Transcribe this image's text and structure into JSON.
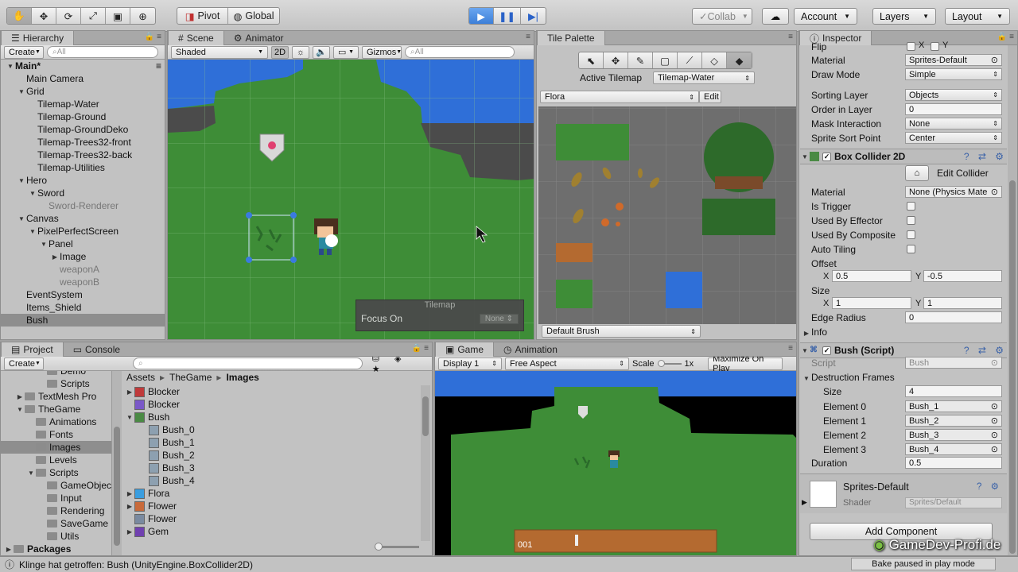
{
  "toolbar": {
    "pivot": "Pivot",
    "global": "Global",
    "collab": "Collab",
    "account": "Account",
    "layers": "Layers",
    "layout": "Layout"
  },
  "hierarchy": {
    "tab": "Hierarchy",
    "create": "Create",
    "search_placeholder": "All",
    "items": [
      {
        "label": "Main*",
        "indent": 0,
        "tri": "▼",
        "bold": true
      },
      {
        "label": "Main Camera",
        "indent": 1,
        "tri": ""
      },
      {
        "label": "Grid",
        "indent": 1,
        "tri": "▼"
      },
      {
        "label": "Tilemap-Water",
        "indent": 2,
        "tri": ""
      },
      {
        "label": "Tilemap-Ground",
        "indent": 2,
        "tri": ""
      },
      {
        "label": "Tilemap-GroundDeko",
        "indent": 2,
        "tri": ""
      },
      {
        "label": "Tilemap-Trees32-front",
        "indent": 2,
        "tri": ""
      },
      {
        "label": "Tilemap-Trees32-back",
        "indent": 2,
        "tri": ""
      },
      {
        "label": "Tilemap-Utilities",
        "indent": 2,
        "tri": ""
      },
      {
        "label": "Hero",
        "indent": 1,
        "tri": "▼"
      },
      {
        "label": "Sword",
        "indent": 2,
        "tri": "▼"
      },
      {
        "label": "Sword-Renderer",
        "indent": 3,
        "tri": "",
        "grey": true
      },
      {
        "label": "Canvas",
        "indent": 1,
        "tri": "▼"
      },
      {
        "label": "PixelPerfectScreen",
        "indent": 2,
        "tri": "▼"
      },
      {
        "label": "Panel",
        "indent": 3,
        "tri": "▼"
      },
      {
        "label": "Image",
        "indent": 4,
        "tri": "▶"
      },
      {
        "label": "weaponA",
        "indent": 4,
        "tri": "",
        "grey": true
      },
      {
        "label": "weaponB",
        "indent": 4,
        "tri": "",
        "grey": true
      },
      {
        "label": "EventSystem",
        "indent": 1,
        "tri": ""
      },
      {
        "label": "Items_Shield",
        "indent": 1,
        "tri": ""
      },
      {
        "label": "Bush",
        "indent": 1,
        "tri": "",
        "selected": true
      }
    ]
  },
  "scene": {
    "tab_scene": "Scene",
    "tab_animator": "Animator",
    "shading": "Shaded",
    "mode2d": "2D",
    "gizmos": "Gizmos",
    "search_placeholder": "All",
    "overlay_title": "Tilemap",
    "focus_label": "Focus On",
    "focus_value": "None"
  },
  "tile_palette": {
    "tab": "Tile Palette",
    "active_tilemap_label": "Active Tilemap",
    "active_tilemap_value": "Tilemap-Water",
    "palette": "Flora",
    "edit": "Edit",
    "brush": "Default Brush"
  },
  "inspector": {
    "tab": "Inspector",
    "flip_label": "Flip",
    "flip_x": "X",
    "flip_y": "Y",
    "material_label": "Material",
    "material_value": "Sprites-Default",
    "draw_mode_label": "Draw Mode",
    "draw_mode_value": "Simple",
    "sorting_layer_label": "Sorting Layer",
    "sorting_layer_value": "Objects",
    "order_label": "Order in Layer",
    "order_value": "0",
    "mask_label": "Mask Interaction",
    "mask_value": "None",
    "sort_point_label": "Sprite Sort Point",
    "sort_point_value": "Center",
    "box_collider": {
      "title": "Box Collider 2D",
      "edit_collider": "Edit Collider",
      "material_label": "Material",
      "material_value": "None (Physics Mate",
      "is_trigger": "Is Trigger",
      "used_by_effector": "Used By Effector",
      "used_by_composite": "Used By Composite",
      "auto_tiling": "Auto Tiling",
      "offset_label": "Offset",
      "offset_x": "0.5",
      "offset_y": "-0.5",
      "size_label": "Size",
      "size_x": "1",
      "size_y": "1",
      "edge_radius_label": "Edge Radius",
      "edge_radius_value": "0",
      "info": "Info",
      "x": "X",
      "y": "Y"
    },
    "bush_script": {
      "title": "Bush (Script)",
      "script_label": "Script",
      "script_value": "Bush",
      "frames_label": "Destruction Frames",
      "size_label": "Size",
      "size_value": "4",
      "elements": [
        {
          "label": "Element 0",
          "value": "Bush_1"
        },
        {
          "label": "Element 1",
          "value": "Bush_2"
        },
        {
          "label": "Element 2",
          "value": "Bush_3"
        },
        {
          "label": "Element 3",
          "value": "Bush_4"
        }
      ],
      "duration_label": "Duration",
      "duration_value": "0.5"
    },
    "material_preview": {
      "name": "Sprites-Default",
      "shader_label": "Shader",
      "shader_value": "Sprites/Default"
    },
    "add_component": "Add Component",
    "watermark": "GameDev-Profi.de"
  },
  "project": {
    "tab_project": "Project",
    "tab_console": "Console",
    "create": "Create",
    "tree": [
      {
        "label": "Demo",
        "indent": 3,
        "tri": ""
      },
      {
        "label": "Scripts",
        "indent": 3,
        "tri": ""
      },
      {
        "label": "TextMesh Pro",
        "indent": 1,
        "tri": "▶"
      },
      {
        "label": "TheGame",
        "indent": 1,
        "tri": "▼"
      },
      {
        "label": "Animations",
        "indent": 2,
        "tri": ""
      },
      {
        "label": "Fonts",
        "indent": 2,
        "tri": ""
      },
      {
        "label": "Images",
        "indent": 2,
        "tri": "",
        "selected": true
      },
      {
        "label": "Levels",
        "indent": 2,
        "tri": ""
      },
      {
        "label": "Scripts",
        "indent": 2,
        "tri": "▼"
      },
      {
        "label": "GameObjec",
        "indent": 3,
        "tri": ""
      },
      {
        "label": "Input",
        "indent": 3,
        "tri": ""
      },
      {
        "label": "Rendering",
        "indent": 3,
        "tri": ""
      },
      {
        "label": "SaveGame",
        "indent": 3,
        "tri": ""
      },
      {
        "label": "Utils",
        "indent": 3,
        "tri": ""
      },
      {
        "label": "Packages",
        "indent": 0,
        "tri": "▶"
      }
    ],
    "breadcrumb": [
      "Assets",
      "TheGame",
      "Images"
    ],
    "assets": [
      {
        "label": "Blocker",
        "indent": 0,
        "tri": "▶",
        "icon": "#c03a3a"
      },
      {
        "label": "Blocker",
        "indent": 0,
        "tri": "",
        "icon": "#7a58c8"
      },
      {
        "label": "Bush",
        "indent": 0,
        "tri": "▼",
        "icon": "#4a8a44"
      },
      {
        "label": "Bush_0",
        "indent": 1,
        "tri": "",
        "icon": "#8da0b0"
      },
      {
        "label": "Bush_1",
        "indent": 1,
        "tri": "",
        "icon": "#8da0b0"
      },
      {
        "label": "Bush_2",
        "indent": 1,
        "tri": "",
        "icon": "#8da0b0"
      },
      {
        "label": "Bush_3",
        "indent": 1,
        "tri": "",
        "icon": "#8da0b0"
      },
      {
        "label": "Bush_4",
        "indent": 1,
        "tri": "",
        "icon": "#8da0b0"
      },
      {
        "label": "Flora",
        "indent": 0,
        "tri": "▶",
        "icon": "#3a9ee0"
      },
      {
        "label": "Flower",
        "indent": 0,
        "tri": "▶",
        "icon": "#c86a3a"
      },
      {
        "label": "Flower",
        "indent": 0,
        "tri": "",
        "icon": "#7a8aa0"
      },
      {
        "label": "Gem",
        "indent": 0,
        "tri": "▶",
        "icon": "#7040b0"
      }
    ]
  },
  "game": {
    "tab_game": "Game",
    "tab_animation": "Animation",
    "display": "Display 1",
    "aspect": "Free Aspect",
    "scale_label": "Scale",
    "scale_value": "1x",
    "maximize": "Maximize On Play",
    "counter": "001"
  },
  "status": {
    "message": "Klinge hat getroffen: Bush (UnityEngine.BoxCollider2D)",
    "bake": "Bake paused in play mode"
  }
}
